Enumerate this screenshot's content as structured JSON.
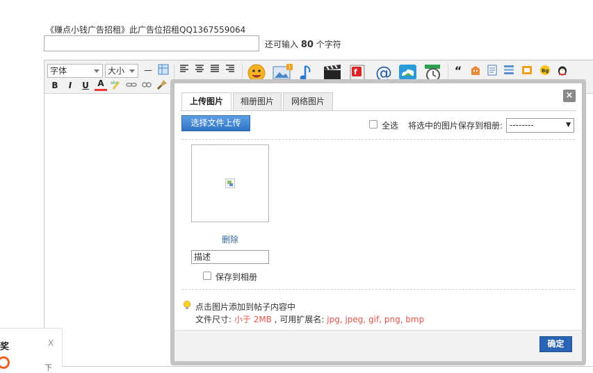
{
  "ad_text": "《赚点小钱广告招租》此广告位招租QQ1367559064",
  "counter": {
    "prefix": "还可输入",
    "count": "80",
    "suffix": "个字符"
  },
  "toolbar": {
    "font_select": "字体",
    "size_select": "大小",
    "bold": "B",
    "italic": "I",
    "underline": "U",
    "font_color": "A",
    "hr": "—",
    "quote": "“"
  },
  "dialog": {
    "tabs": [
      {
        "label": "上传图片",
        "active": true
      },
      {
        "label": "相册图片",
        "active": false
      },
      {
        "label": "网络图片",
        "active": false
      }
    ],
    "close": "×",
    "upload_button": "选择文件上传",
    "select_all": "全选",
    "save_to_album_label": "将选中的图片保存到相册:",
    "album_select_value": "--------",
    "image": {
      "delete": "删除",
      "desc_placeholder": "描述",
      "save_to_album": "保存到相册"
    },
    "tip": "点击图片添加到帖子内容中",
    "size_info": {
      "label": "文件尺寸:",
      "limit": "小于 2MB",
      "ext_label": ", 可用扩展名:",
      "exts": "jpg, jpeg, gif, png, bmp"
    },
    "ok": "确定"
  },
  "side_popup": {
    "title": "奖",
    "close": "X",
    "more": "下"
  },
  "colors": {
    "primary_blue": "#2a65b5",
    "accent_red": "#e7574c",
    "link": "#336699"
  }
}
